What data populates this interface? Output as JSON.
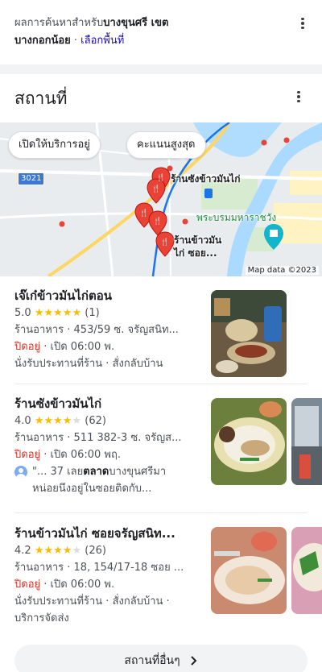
{
  "header": {
    "prefix": "ผลการค้นหาสำหรับ",
    "location_bold_1": "บางขุนศรี เขต",
    "location_bold_2": "บางกอกน้อย",
    "separator": " · ",
    "choose_area_link": "เลือกพื้นที่",
    "menu_icon": "more-vert-icon"
  },
  "section": {
    "title": "สถานที่",
    "menu_icon": "more-vert-icon"
  },
  "map": {
    "chips": [
      "เปิดให้บริการอยู่",
      "คะแนนสูงสุด"
    ],
    "labels": {
      "place_1": "ร้านซังข้าวมันไก่",
      "landmark": "พระบรมมหาราชวัง",
      "place_2_line1": "ร้านข้าวมัน",
      "place_2_line2": "ไก่ ซอย..."
    },
    "road_number": "3021",
    "attribution": "Map data ©2023",
    "colors": {
      "water": "#aadaff",
      "marker": "#ea4335",
      "road": "#ffffff",
      "rail": "#1a73e8"
    }
  },
  "listings": [
    {
      "name": "เจ๊เก๋ข้าวมันไก่ตอน",
      "rating": "5.0",
      "stars": 5,
      "reviews": "(1)",
      "info": "ร้านอาหาร · 453/59 ซ. จรัญสนิท...",
      "status": "ปิดอยู่",
      "hours": " · เปิด 06:00 พ.",
      "services": "นั่งรับประทานที่ร้าน · สั่งกลับบ้าน"
    },
    {
      "name": "ร้านซังข้าวมันไก่",
      "rating": "4.0",
      "stars": 4,
      "reviews": "(62)",
      "info": "ร้านอาหาร · 511 382-3 ซ. จรัญส...",
      "status": "ปิดอยู่",
      "hours": " · เปิด 06:00 พฤ.",
      "review_prefix": "\"... 37 เลย",
      "review_bold": "ตลาด",
      "review_suffix": "บางขุนศรีมา",
      "review_line2": "หน่อยนึงอยู่ในซอยติดกับ..."
    },
    {
      "name": "ร้านข้าวมันไก่ ซอยจรัญสนิท...",
      "rating": "4.2",
      "stars": 4,
      "reviews": "(26)",
      "info": "ร้านอาหาร · 18, 154/17-18 ซอย ...",
      "status": "ปิดอยู่",
      "hours": " · เปิด 06:00 พ.",
      "services": "นั่งรับประทานที่ร้าน · สั่งกลับบ้าน ·",
      "services_line2": "บริการจัดส่ง"
    }
  ],
  "more_places": {
    "label": "สถานที่อื่นๆ",
    "icon": "chevron-right-icon"
  }
}
